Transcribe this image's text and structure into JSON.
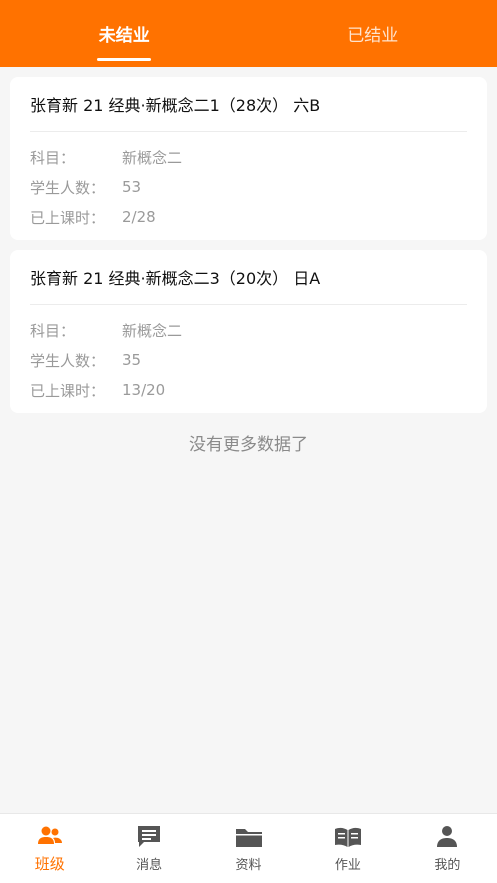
{
  "tabs": [
    {
      "label": "未结业",
      "active": true
    },
    {
      "label": "已结业",
      "active": false
    }
  ],
  "classes": [
    {
      "title": "张育新 21 经典·新概念二1（28次） 六B",
      "subject_label": "科目：",
      "subject": "新概念二",
      "students_label": "学生人数：",
      "students": "53",
      "progress_label": "已上课时：",
      "progress": "2/28"
    },
    {
      "title": "张育新 21 经典·新概念二3（20次） 日A",
      "subject_label": "科目：",
      "subject": "新概念二",
      "students_label": "学生人数：",
      "students": "35",
      "progress_label": "已上课时：",
      "progress": "13/20"
    }
  ],
  "no_more_text": "没有更多数据了",
  "bottom_nav": [
    {
      "label": "班级",
      "icon": "people-icon",
      "active": true
    },
    {
      "label": "消息",
      "icon": "message-icon",
      "active": false
    },
    {
      "label": "资料",
      "icon": "folder-icon",
      "active": false
    },
    {
      "label": "作业",
      "icon": "book-icon",
      "active": false
    },
    {
      "label": "我的",
      "icon": "person-icon",
      "active": false
    }
  ],
  "colors": {
    "accent": "#ff7200",
    "inactive_icon": "#555555"
  }
}
